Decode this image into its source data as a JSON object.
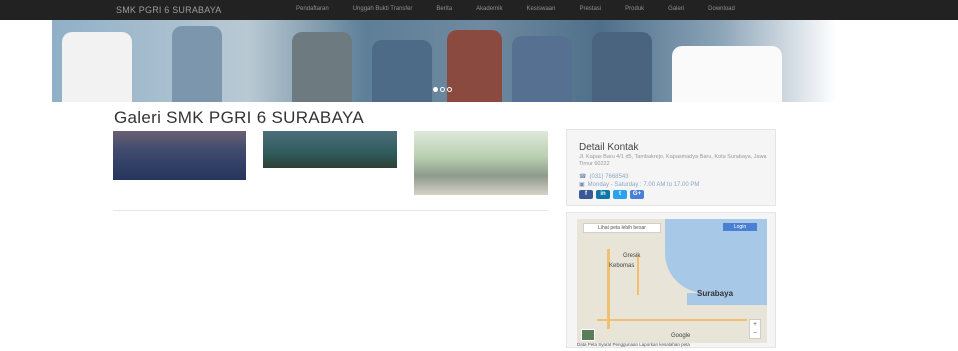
{
  "navbar": {
    "brand": "SMK PGRI 6 SURABAYA",
    "items": [
      "Pendaftaran",
      "Unggah Bukti Transfer",
      "Berita",
      "Akademik",
      "Kesiswaan",
      "Prestasi",
      "Produk",
      "Galeri",
      "Download"
    ]
  },
  "hero": {
    "indicators": 3,
    "active_index": 0
  },
  "page": {
    "title": "Galeri SMK PGRI 6 SURABAYA"
  },
  "contact": {
    "heading": "Detail Kontak",
    "address": "Jl. Kapas Baru 4/1 d5, Tambakrejo, Kapasmadya Baru, Kota Surabaya, Jawa Timur 60222",
    "phone": "(031) 7668543",
    "hours": "Monday - Saturday : 7.00 AM to 17.00 PM",
    "social": [
      "f",
      "in",
      "t",
      "G+"
    ]
  },
  "map": {
    "larger_map_label": "Lihat peta lebih besar",
    "login_label": "Login",
    "labels": {
      "gresik": "Gresik",
      "kebomas": "Kebomas",
      "surabaya": "Surabaya",
      "google": "Google"
    },
    "footer": "Data Peta    Syarat Penggunaan    Laporkan kesalahan peta"
  },
  "colors": {
    "navbar_bg": "#222222",
    "social_facebook": "#3b5998",
    "social_linkedin": "#0e76a8",
    "social_twitter": "#2aa3ef",
    "social_google": "#4a7fd6"
  }
}
